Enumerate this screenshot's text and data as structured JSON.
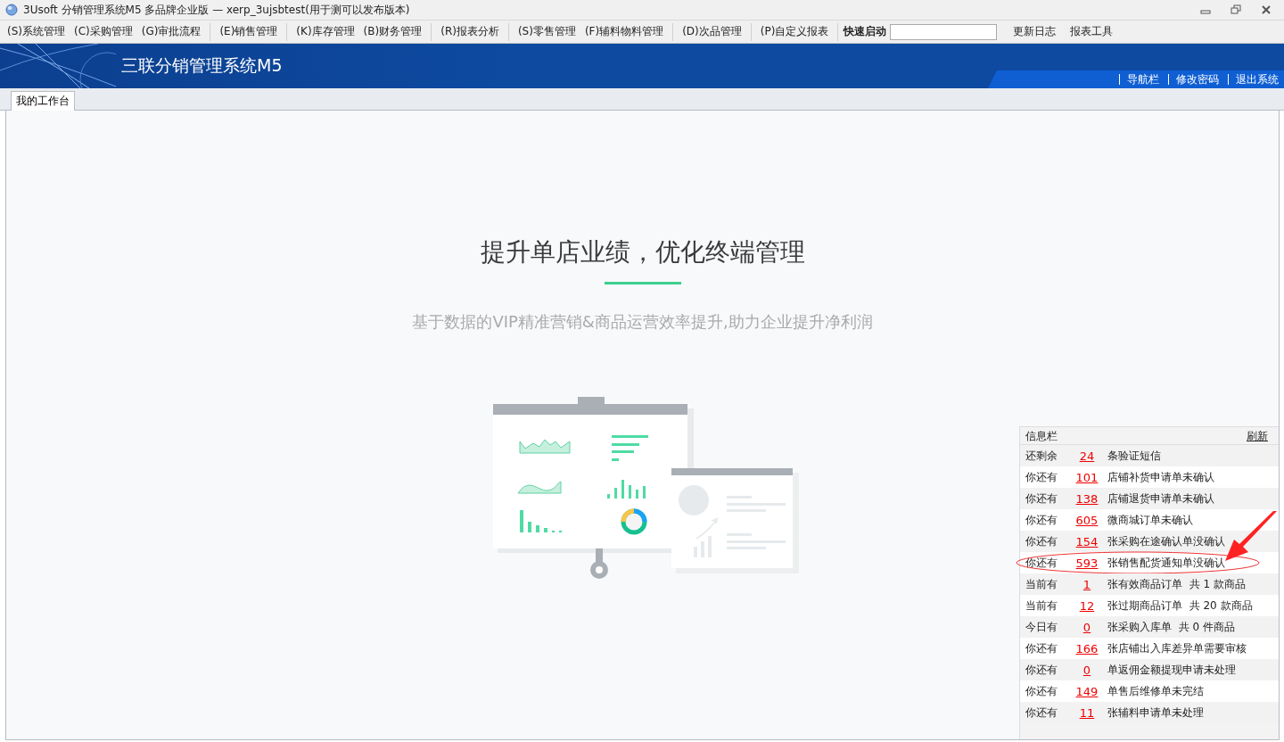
{
  "window": {
    "title": "3Usoft 分销管理系统M5 多品牌企业版 — xerp_3ujsbtest(用于测可以发布版本)"
  },
  "menu_groups": [
    [
      "(S)系统管理",
      "(C)采购管理",
      "(G)审批流程"
    ],
    [
      "(E)销售管理"
    ],
    [
      "(K)库存管理",
      "(B)财务管理"
    ],
    [
      "(R)报表分析"
    ],
    [
      "(S)零售管理",
      "(F)辅料物料管理"
    ],
    [
      "(D)次品管理"
    ],
    [
      "(P)自定义报表"
    ]
  ],
  "quick_launch": {
    "label": "快速启动"
  },
  "menu_extra": [
    "更新日志",
    "报表工具"
  ],
  "banner": {
    "title": "三联分销管理系统M5",
    "links": [
      "导航栏",
      "修改密码",
      "退出系统"
    ]
  },
  "tabs": [
    {
      "label": "我的工作台",
      "selected": true
    }
  ],
  "hero": {
    "headline": "提升单店业绩，优化终端管理",
    "subtitle": "基于数据的VIP精准营销&商品运营效率提升,助力企业提升净利润"
  },
  "info_panel": {
    "title": "信息栏",
    "refresh": "刷新",
    "rows": [
      {
        "prefix": "还剩余",
        "count": "24",
        "text": "条验证短信",
        "highlighted": false
      },
      {
        "prefix": "你还有",
        "count": "101",
        "text": "店铺补货申请单未确认",
        "highlighted": false
      },
      {
        "prefix": "你还有",
        "count": "138",
        "text": "店铺退货申请单未确认",
        "highlighted": false
      },
      {
        "prefix": "你还有",
        "count": "605",
        "text": "微商城订单未确认",
        "highlighted": false
      },
      {
        "prefix": "你还有",
        "count": "154",
        "text": "张采购在途确认单没确认",
        "highlighted": false
      },
      {
        "prefix": "你还有",
        "count": "593",
        "text": "张销售配货通知单没确认",
        "highlighted": true
      },
      {
        "prefix": "当前有",
        "count": "1",
        "text": "张有效商品订单  共 1 款商品",
        "highlighted": false
      },
      {
        "prefix": "当前有",
        "count": "12",
        "text": "张过期商品订单  共 20 款商品",
        "highlighted": false
      },
      {
        "prefix": "今日有",
        "count": "0",
        "text": "张采购入库单  共 0 件商品",
        "highlighted": false
      },
      {
        "prefix": "你还有",
        "count": "166",
        "text": "张店铺出入库差异单需要审核",
        "highlighted": false
      },
      {
        "prefix": "你还有",
        "count": "0",
        "text": "单返佣金额提现申请未处理",
        "highlighted": false
      },
      {
        "prefix": "你还有",
        "count": "149",
        "text": "单售后维修单未完结",
        "highlighted": false
      },
      {
        "prefix": "你还有",
        "count": "11",
        "text": "张辅料申请单未处理",
        "highlighted": false
      }
    ]
  }
}
